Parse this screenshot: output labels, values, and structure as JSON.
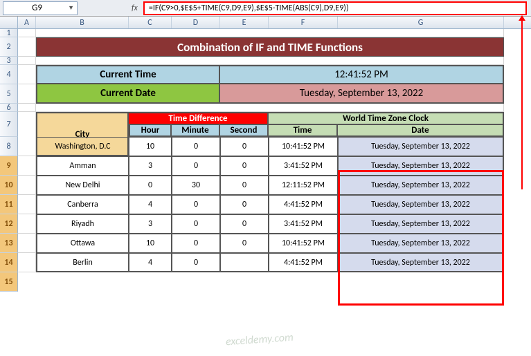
{
  "nameBox": "G9",
  "formula": "=IF(C9>0,$E$5+TIME(C9,D9,E9),$E$5-TIME(ABS(C9),D9,E9))",
  "fx": "fx",
  "title": "Combination of IF and TIME Functions",
  "currentTimeLabel": "Current Time",
  "currentTimeValue": "12:41:52 PM",
  "currentDateLabel": "Current Date",
  "currentDateValue": "Tuesday, September 13, 2022",
  "headers": {
    "city": "City",
    "timeDiff": "Time Difference",
    "hour": "Hour",
    "minute": "Minute",
    "second": "Second",
    "worldClock": "World Time Zone Clock",
    "time": "Time",
    "date": "Date"
  },
  "cols": [
    "A",
    "B",
    "C",
    "D",
    "E",
    "F",
    "G"
  ],
  "rows": [
    {
      "city": "Washington, D.C",
      "h": "10",
      "m": "0",
      "s": "0",
      "time": "10:41:52 PM",
      "date": "Tuesday, September 13, 2022"
    },
    {
      "city": "Amman",
      "h": "3",
      "m": "0",
      "s": "0",
      "time": "3:41:52 PM",
      "date": "Tuesday, September 13, 2022"
    },
    {
      "city": "New Delhi",
      "h": "0",
      "m": "30",
      "s": "0",
      "time": "12:11:52 PM",
      "date": "Tuesday, September 13, 2022"
    },
    {
      "city": "Canberra",
      "h": "4",
      "m": "0",
      "s": "0",
      "time": "4:41:52 PM",
      "date": "Tuesday, September 13, 2022"
    },
    {
      "city": "Riyadh",
      "h": "3",
      "m": "0",
      "s": "0",
      "time": "3:41:52 PM",
      "date": "Tuesday, September 13, 2022"
    },
    {
      "city": "Ottawa",
      "h": "10",
      "m": "0",
      "s": "0",
      "time": "10:41:52 PM",
      "date": "Tuesday, September 13, 2022"
    },
    {
      "city": "Berlin",
      "h": "4",
      "m": "0",
      "s": "",
      "time": "4:41:52 PM",
      "date": "Tuesday, September 13, 2022"
    }
  ],
  "watermark": "exceldemy.com"
}
